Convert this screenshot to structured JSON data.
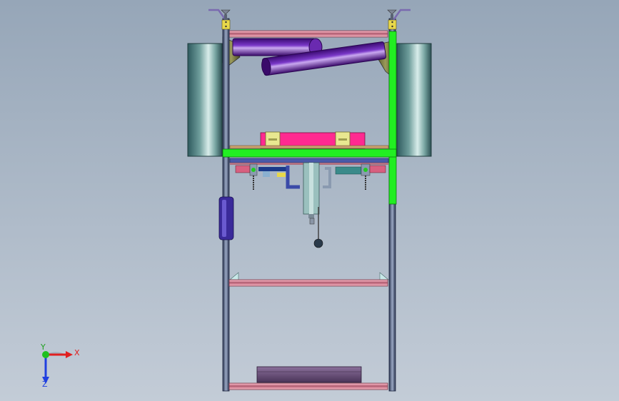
{
  "viewport": {
    "background_top": "#96a6b8",
    "background_bottom": "#c3ccd7"
  },
  "triad": {
    "x_label": "X",
    "y_label": "Y",
    "z_label": "Z",
    "x_color": "#e02020",
    "y_color": "#20c020",
    "z_color": "#2040e0"
  },
  "colors": {
    "frame_post": "#6f7f9a",
    "frame_rail": "#e8a0b0",
    "green_beam": "#22ee22",
    "tank": "#5f8f8f",
    "purple_roller": "#5a1a9a",
    "magenta_plate": "#ff2a90",
    "yellow_block": "#e8e890",
    "base_block": "#6a4f78"
  }
}
